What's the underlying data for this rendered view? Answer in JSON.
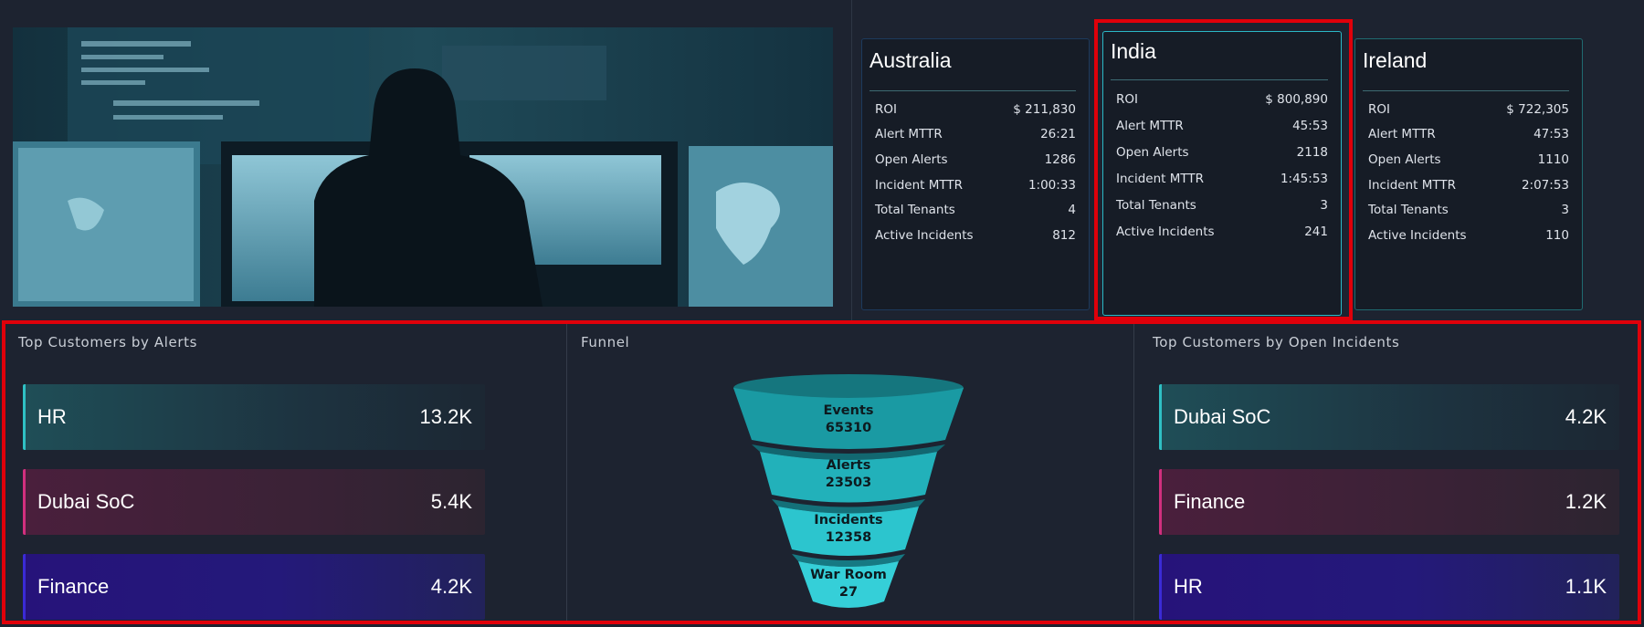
{
  "regions": [
    {
      "name": "Australia",
      "rows": [
        {
          "label": "ROI",
          "value": "$ 211,830"
        },
        {
          "label": "Alert MTTR",
          "value": "26:21"
        },
        {
          "label": "Open Alerts",
          "value": "1286"
        },
        {
          "label": "Incident MTTR",
          "value": "1:00:33"
        },
        {
          "label": "Total Tenants",
          "value": "4"
        },
        {
          "label": "Active Incidents",
          "value": "812"
        }
      ]
    },
    {
      "name": "India",
      "rows": [
        {
          "label": "ROI",
          "value": "$ 800,890"
        },
        {
          "label": "Alert MTTR",
          "value": "45:53"
        },
        {
          "label": "Open Alerts",
          "value": "2118"
        },
        {
          "label": "Incident MTTR",
          "value": "1:45:53"
        },
        {
          "label": "Total Tenants",
          "value": "3"
        },
        {
          "label": "Active Incidents",
          "value": "241"
        }
      ]
    },
    {
      "name": "Ireland",
      "rows": [
        {
          "label": "ROI",
          "value": "$ 722,305"
        },
        {
          "label": "Alert MTTR",
          "value": "47:53"
        },
        {
          "label": "Open Alerts",
          "value": "1110"
        },
        {
          "label": "Incident MTTR",
          "value": "2:07:53"
        },
        {
          "label": "Total Tenants",
          "value": "3"
        },
        {
          "label": "Active Incidents",
          "value": "110"
        }
      ]
    }
  ],
  "top_alerts": {
    "title": "Top Customers by Alerts",
    "items": [
      {
        "name": "HR",
        "value": "13.2K",
        "color": "#2fc0c4"
      },
      {
        "name": "Dubai SoC",
        "value": "5.4K",
        "color": "#d12f7e"
      },
      {
        "name": "Finance",
        "value": "4.2K",
        "color": "#3a2bd6"
      }
    ]
  },
  "funnel": {
    "title": "Funnel",
    "stages": [
      {
        "name": "Events",
        "value": "65310"
      },
      {
        "name": "Alerts",
        "value": "23503"
      },
      {
        "name": "Incidents",
        "value": "12358"
      },
      {
        "name": "War Room",
        "value": "27"
      }
    ]
  },
  "top_incidents": {
    "title": "Top Customers by Open Incidents",
    "items": [
      {
        "name": "Dubai SoC",
        "value": "4.2K",
        "color": "#2fc0c4"
      },
      {
        "name": "Finance",
        "value": "1.2K",
        "color": "#d12f7e"
      },
      {
        "name": "HR",
        "value": "1.1K",
        "color": "#3a2bd6"
      }
    ]
  },
  "colors": {
    "accent": "#2bb8c6",
    "highlight": "#e0000a",
    "background": "#1d2330"
  }
}
